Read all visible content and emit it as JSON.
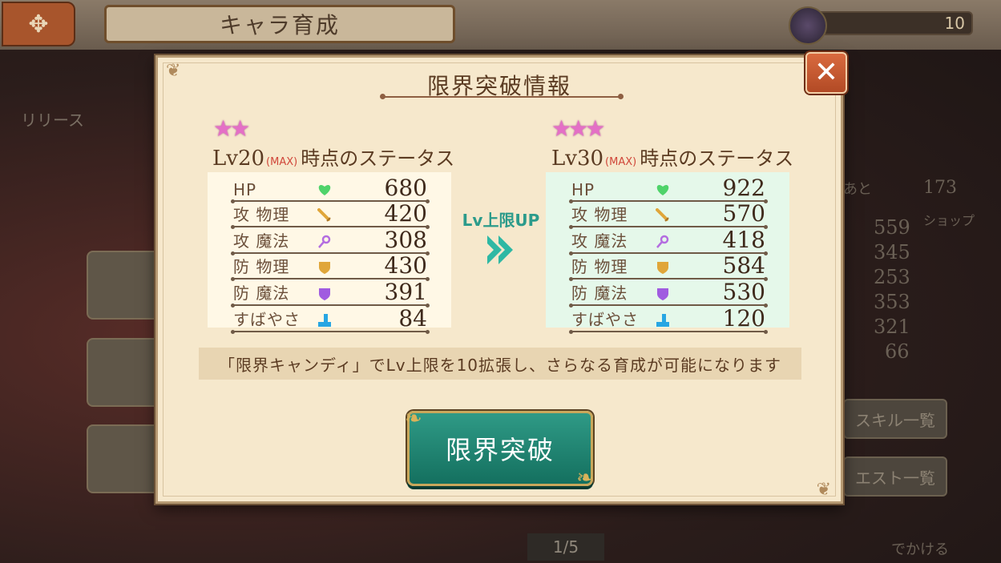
{
  "screen": {
    "title": "キャラ育成",
    "stamina_value": "10",
    "background_texts": {
      "release_notice": "リリース",
      "remaining_label": "あと",
      "remaining_value": "173",
      "shop_label": "ショップ",
      "stats": [
        "559",
        "345",
        "253",
        "353",
        "321",
        "66"
      ],
      "skill_list_button": "スキル一覧",
      "quest_list_button": "エスト一覧",
      "go_out_button": "でかける",
      "page_indicator": "1/5"
    }
  },
  "modal": {
    "title": "限界突破情報",
    "close_icon": "close-icon",
    "before": {
      "stars": "★★",
      "level": "Lv20",
      "max_tag": "(MAX)",
      "suffix": "時点のステータス"
    },
    "after": {
      "stars": "★★★",
      "level": "Lv30",
      "max_tag": "(MAX)",
      "suffix": "時点のステータス"
    },
    "arrow_label": "Lv上限UP",
    "stat_labels": [
      "HP",
      "攻 物理",
      "攻 魔法",
      "防 物理",
      "防 魔法",
      "すばやさ"
    ],
    "stat_icons": [
      "heart-icon",
      "sword-icon",
      "wand-icon",
      "shield-icon",
      "magic-shield-icon",
      "boot-icon"
    ],
    "before_values": [
      "680",
      "420",
      "308",
      "430",
      "391",
      "84"
    ],
    "after_values": [
      "922",
      "570",
      "418",
      "584",
      "530",
      "120"
    ],
    "note": "「限界キャンディ」でLv上限を10拡張し、さらなる育成が可能になります",
    "confirm_button": "限界突破"
  },
  "colors": {
    "modal_bg": "#f6e8cc",
    "button_teal": "#1f8672",
    "close_orange": "#c8582f",
    "star_pink": "#e46fc6",
    "accent_teal": "#2c9b8b"
  }
}
